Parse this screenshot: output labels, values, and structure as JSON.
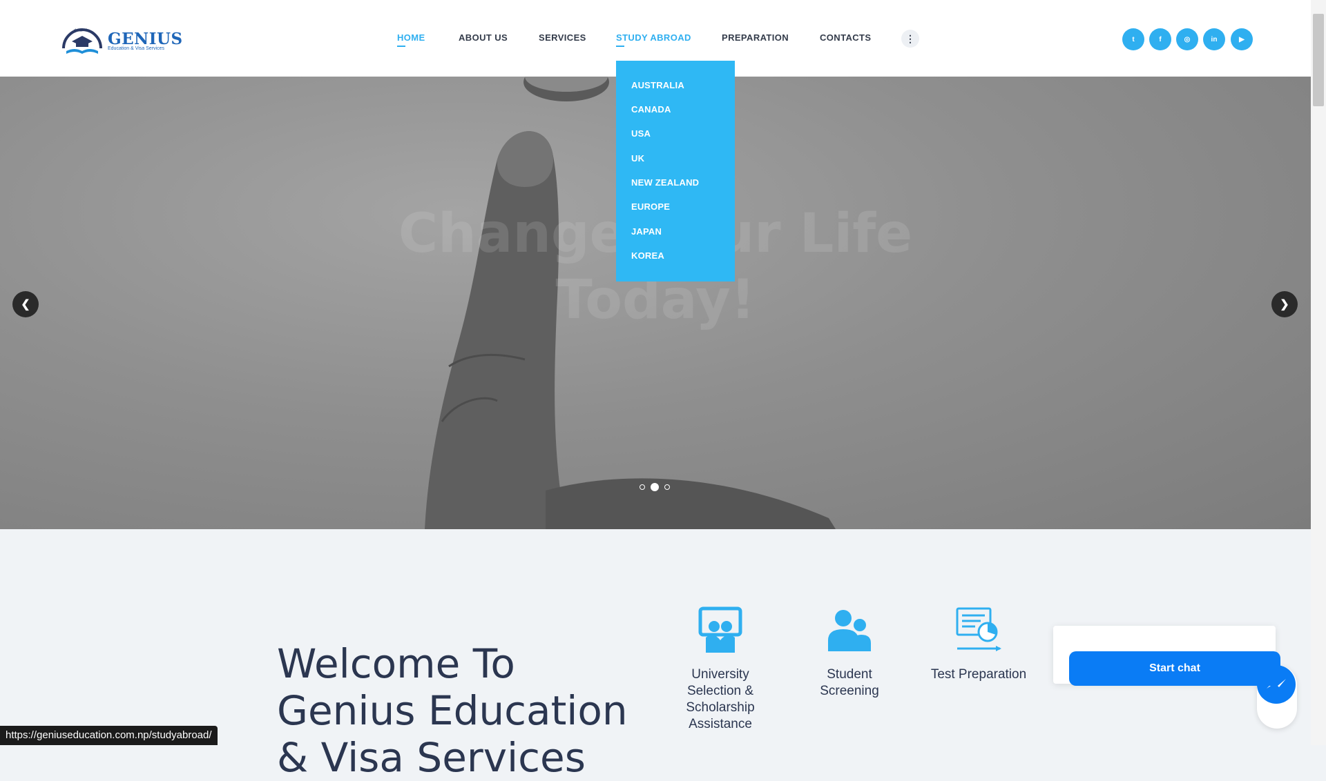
{
  "header": {
    "logo": {
      "name": "GENIUS",
      "tagline": "Education & Visa Services"
    },
    "nav": [
      {
        "label": "HOME",
        "active": true
      },
      {
        "label": "ABOUT US",
        "active": false
      },
      {
        "label": "SERVICES",
        "active": false
      },
      {
        "label": "STUDY ABROAD",
        "active": true
      },
      {
        "label": "PREPARATION",
        "active": false
      },
      {
        "label": "CONTACTS",
        "active": false
      }
    ],
    "more_icon": "vertical-dots-icon",
    "social": [
      {
        "icon": "twitter-icon",
        "glyph": "t"
      },
      {
        "icon": "facebook-icon",
        "glyph": "f"
      },
      {
        "icon": "instagram-icon",
        "glyph": "◎"
      },
      {
        "icon": "linkedin-icon",
        "glyph": "in"
      },
      {
        "icon": "youtube-icon",
        "glyph": "▶"
      }
    ]
  },
  "dropdown": {
    "items": [
      "AUSTRALIA",
      "CANADA",
      "USA",
      "UK",
      "NEW ZEALAND",
      "EUROPE",
      "JAPAN",
      "KOREA"
    ]
  },
  "hero": {
    "title_line1": "Change Your Life",
    "title_line2": "Today!",
    "prev_icon": "chevron-left-icon",
    "next_icon": "chevron-right-icon",
    "slides": 3,
    "active_slide": 2
  },
  "welcome": {
    "line1": "Welcome To",
    "line2": "Genius Education",
    "line3": "& Visa Services"
  },
  "features": [
    {
      "icon": "presentation-board-icon",
      "label": "University Selection & Scholarship Assistance"
    },
    {
      "icon": "users-icon",
      "label": "Student Screening"
    },
    {
      "icon": "test-chart-icon",
      "label": "Test Preparation"
    }
  ],
  "chat": {
    "button_label": "Start chat",
    "messenger_icon": "messenger-icon"
  },
  "status_url": "https://geniuseducation.com.np/studyabroad/",
  "colors": {
    "accent": "#2faff0",
    "dropdown": "#2fb8f4",
    "text": "#2b3650",
    "chat": "#0a7cf5"
  }
}
